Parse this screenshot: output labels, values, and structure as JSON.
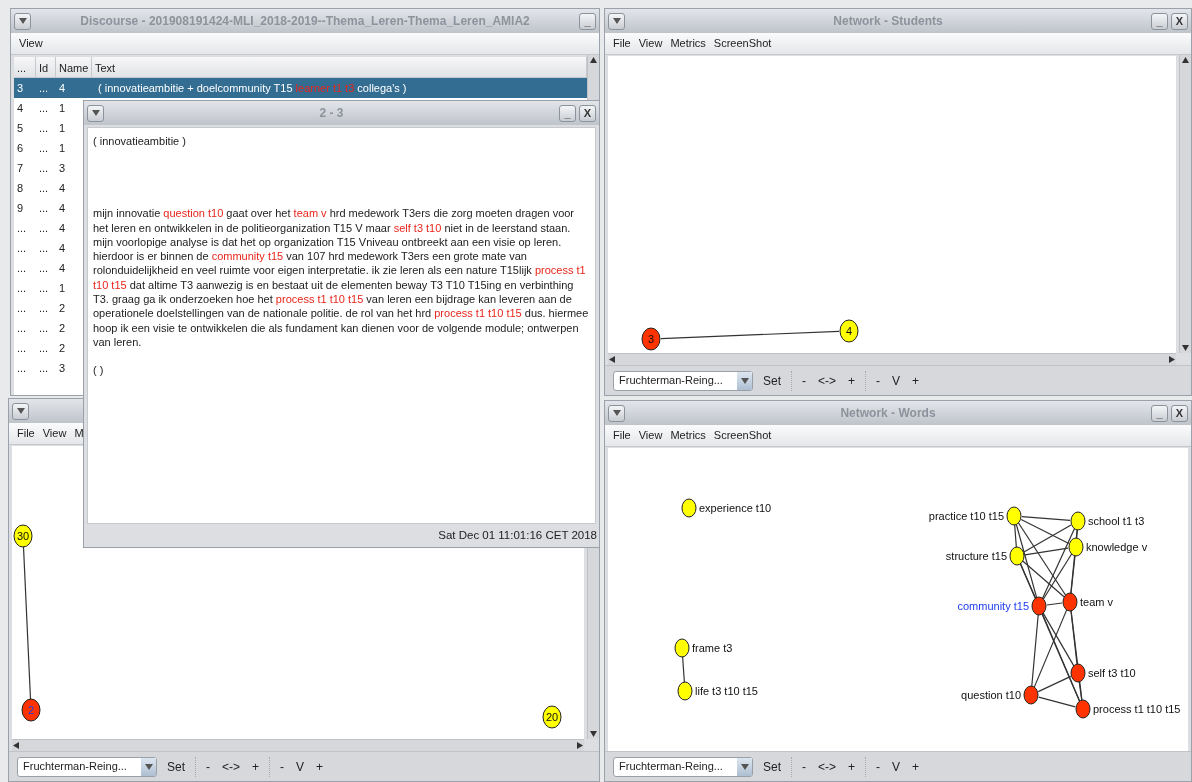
{
  "discourse": {
    "title": "Discourse - 201908191424-MLI_2018-2019--Thema_Leren-Thema_Leren_AMIA2",
    "title_buttons": [
      "_"
    ],
    "menu": [
      "View"
    ],
    "table": {
      "columns": [
        "...",
        "Id",
        "Name",
        "Text"
      ],
      "rows": [
        {
          "cells": [
            "3",
            "...",
            "4"
          ],
          "text": [
            {
              "text": "( innovatieambitie + doelcommunity T15 ",
              "tagged": false
            },
            {
              "text": "learner t1 t3",
              "tagged": true
            },
            {
              "text": " collega's )",
              "tagged": false
            }
          ],
          "selected": true
        },
        {
          "cells": [
            "4",
            "...",
            "1"
          ],
          "selected": false
        },
        {
          "cells": [
            "5",
            "...",
            "1"
          ],
          "selected": false
        },
        {
          "cells": [
            "6",
            "...",
            "1"
          ],
          "selected": false
        },
        {
          "cells": [
            "7",
            "...",
            "3"
          ],
          "selected": false
        },
        {
          "cells": [
            "8",
            "...",
            "4"
          ],
          "selected": false
        },
        {
          "cells": [
            "9",
            "...",
            "4"
          ],
          "selected": false
        },
        {
          "cells": [
            "...",
            "...",
            "4"
          ],
          "selected": false
        },
        {
          "cells": [
            "...",
            "...",
            "4"
          ],
          "selected": false
        },
        {
          "cells": [
            "...",
            "...",
            "4"
          ],
          "selected": false
        },
        {
          "cells": [
            "...",
            "...",
            "1"
          ],
          "selected": false
        },
        {
          "cells": [
            "...",
            "...",
            "2"
          ],
          "selected": false
        },
        {
          "cells": [
            "...",
            "...",
            "2"
          ],
          "selected": false
        },
        {
          "cells": [
            "...",
            "...",
            "2"
          ],
          "selected": false
        },
        {
          "cells": [
            "...",
            "...",
            "3"
          ],
          "selected": false
        }
      ]
    }
  },
  "students_network": {
    "title": "Network - Students",
    "title_buttons": [
      "_",
      "X"
    ],
    "menu": [
      "File",
      "View",
      "Metrics",
      "ScreenShot"
    ],
    "scrollbars": true,
    "nodes": [
      {
        "label": "3",
        "color": "#ff3300",
        "selected": false
      },
      {
        "label": "4",
        "color": "#ffff00",
        "selected": false
      }
    ],
    "toolbar": {
      "layout": "Fruchterman-Reing...",
      "buttons": [
        "Set",
        "-",
        "<->",
        "+",
        "-",
        "V",
        "+"
      ]
    }
  },
  "lower_network": {
    "menu": [
      "File",
      "View",
      "M"
    ],
    "scrollbars": true,
    "nodes": [
      {
        "label": "30",
        "color": "#ffff00",
        "selected": false
      },
      {
        "label": "2",
        "color": "#ff3300",
        "selected": true
      },
      {
        "label": "20",
        "color": "#ffff00",
        "selected": false
      }
    ],
    "toolbar": {
      "layout": "Fruchterman-Reing...",
      "buttons": [
        "Set",
        "-",
        "<->",
        "+",
        "-",
        "V",
        "+"
      ]
    }
  },
  "words_network": {
    "title": "Network - Words",
    "title_buttons": [
      "_",
      "X"
    ],
    "menu": [
      "File",
      "View",
      "Metrics",
      "ScreenShot"
    ],
    "scrollbars": false,
    "nodes": [
      {
        "label": "experience t10",
        "color": "#ffff00",
        "selected": false
      },
      {
        "label": "practice t10 t15",
        "color": "#ffff00",
        "selected": false
      },
      {
        "label": "school t1 t3",
        "color": "#ffff00",
        "selected": false
      },
      {
        "label": "knowledge v",
        "color": "#ffff00",
        "selected": false
      },
      {
        "label": "structure t15",
        "color": "#ffff00",
        "selected": false
      },
      {
        "label": "community t15",
        "color": "#ff3300",
        "selected": true
      },
      {
        "label": "team v",
        "color": "#ff3300",
        "selected": false
      },
      {
        "label": "self t3 t10",
        "color": "#ff3300",
        "selected": false
      },
      {
        "label": "question t10",
        "color": "#ff3300",
        "selected": false
      },
      {
        "label": "process t1 t10 t15",
        "color": "#ff3300",
        "selected": false
      },
      {
        "label": "frame t3",
        "color": "#ffff00",
        "selected": false
      },
      {
        "label": "life t3 t10 t15",
        "color": "#ffff00",
        "selected": false
      }
    ],
    "toolbar": {
      "layout": "Fruchterman-Reing...",
      "buttons": [
        "Set",
        "-",
        "<->",
        "+",
        "-",
        "V",
        "+"
      ]
    }
  },
  "message_window": {
    "title": "2 - 3",
    "title_buttons": [
      "_",
      "X"
    ],
    "paragraphs": [
      [
        {
          "text": "( innovatieambitie )",
          "tagged": false
        }
      ],
      [
        {
          "text": "mijn innovatie ",
          "tagged": false
        },
        {
          "text": "question t10",
          "tagged": true
        },
        {
          "text": " gaat over het ",
          "tagged": false
        },
        {
          "text": "team v",
          "tagged": true
        },
        {
          "text": " hrd medework T3ers die zorg moeten dragen voor het leren en ontwikkelen in de politieorganization T15 V maar ",
          "tagged": false
        },
        {
          "text": "self t3 t10",
          "tagged": true
        },
        {
          "text": " niet in de leerstand staan. mijn voorlopige analyse is dat het op organization T15 Vniveau ontbreekt aan een visie op leren. hierdoor is er binnen de ",
          "tagged": false
        },
        {
          "text": "community t15",
          "tagged": true
        },
        {
          "text": " van 107 hrd medework T3ers een grote mate van rolonduidelijkheid en veel ruimte voor eigen interpretatie. ik zie leren als een nature T15lijk ",
          "tagged": false
        },
        {
          "text": "process t1 t10 t15",
          "tagged": true
        },
        {
          "text": " dat altime T3 aanwezig is en bestaat uit de elementen beway T3 T10 T15ing en verbinthing T3. graag ga ik onderzoeken hoe het ",
          "tagged": false
        },
        {
          "text": "process t1 t10 t15",
          "tagged": true
        },
        {
          "text": " van leren een bijdrage kan leveren aan de operationele doelstellingen van de nationale politie. de rol van het hrd ",
          "tagged": false
        },
        {
          "text": "process t1 t10 t15",
          "tagged": true
        },
        {
          "text": " dus. hiermee hoop ik een visie te ontwikkelen die als fundament kan dienen voor de volgende module; ontwerpen van leren.",
          "tagged": false
        }
      ],
      [
        {
          "text": "( )",
          "tagged": false
        }
      ]
    ],
    "status": "Sat Dec 01 11:01:16 CET 2018"
  }
}
